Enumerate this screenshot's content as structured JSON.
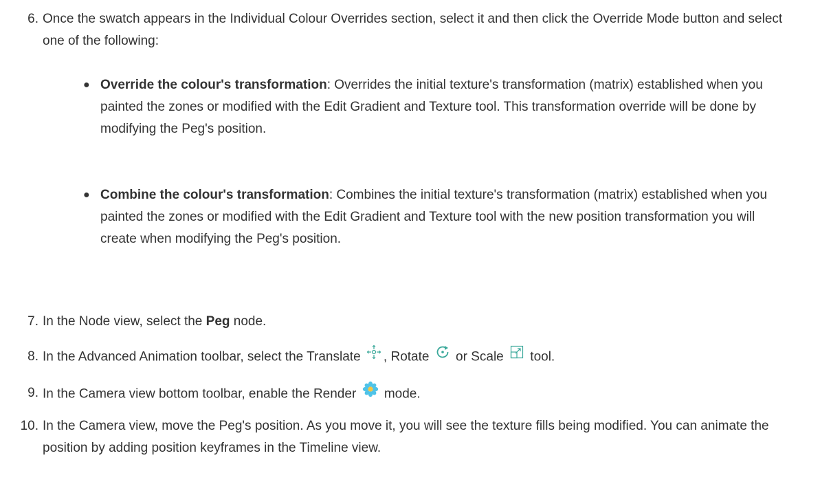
{
  "steps": {
    "s6": {
      "number": "6.",
      "text": "Once the swatch appears in the Individual Colour Overrides section, select it and then click the Override Mode button and select one of the following:",
      "bullets": [
        {
          "bold": "Override the colour's transformation",
          "text": ": Overrides the initial texture's transformation (matrix) established when you painted the zones or modified with the Edit Gradient and Texture tool. This transformation override will be done by modifying the Peg's position."
        },
        {
          "bold": "Combine the colour's transformation",
          "text": ": Combines the initial texture's transformation (matrix) established when you painted the zones or modified with the Edit Gradient and Texture tool with the new position transformation you will create when modifying the Peg's position."
        }
      ]
    },
    "s7": {
      "number": "7.",
      "before": "In the Node view, select the ",
      "bold": "Peg",
      "after": " node."
    },
    "s8": {
      "number": "8.",
      "before": "In the Advanced Animation toolbar, select the Translate",
      "mid1": ", Rotate",
      "mid2": "or Scale",
      "after": "tool."
    },
    "s9": {
      "number": "9.",
      "before": "In the Camera view bottom toolbar, enable the Render",
      "after": "mode."
    },
    "s10": {
      "number": "10.",
      "text": "In the Camera view, move the Peg's position. As you move it, you will see the texture fills being modified. You can animate the position by adding position keyframes in the Timeline view."
    }
  },
  "icons": {
    "translate": "translate-icon",
    "rotate": "rotate-icon",
    "scale": "scale-icon",
    "render": "render-icon"
  },
  "colors": {
    "text": "#333333",
    "icon_teal": "#3aa89a",
    "icon_blue": "#2a9fd6",
    "render_flower": "#4fc3e8"
  }
}
